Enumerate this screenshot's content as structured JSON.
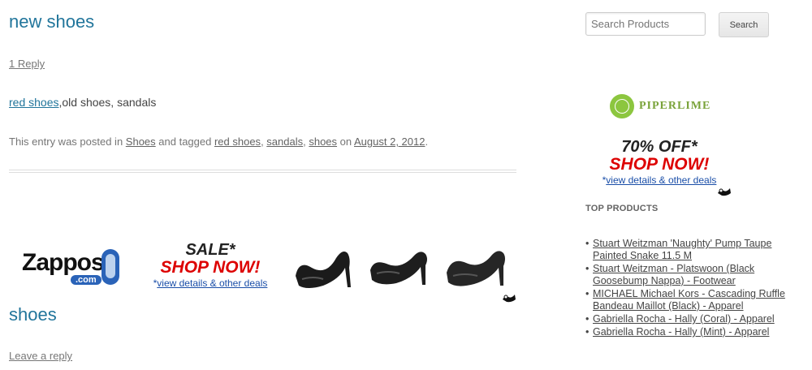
{
  "post1": {
    "title": "new shoes",
    "reply_link": "1 Reply",
    "tags_content": {
      "link_text": "red shoes",
      "rest_text": ",old shoes, sandals"
    },
    "meta": {
      "prefix": "This entry was posted in ",
      "category": "Shoes",
      "tagged_text": " and tagged ",
      "tag1": "red shoes",
      "sep1": ", ",
      "tag2": "sandals",
      "sep2": ", ",
      "tag3": "shoes",
      "on_text": " on ",
      "date": "August 2, 2012",
      "end": "."
    }
  },
  "banner": {
    "brand": "Zappos",
    "brand_suffix": ".com",
    "sale_text": "SALE*",
    "shop_now": "SHOP NOW!",
    "deals_prefix": "*",
    "deals_link": "view details & other deals"
  },
  "post2": {
    "title": "shoes",
    "reply_link": "Leave a reply"
  },
  "sidebar": {
    "search_placeholder": "Search Products",
    "search_button": "Search",
    "ad": {
      "brand": "PIPERLIME",
      "offer_text": "70% OFF*",
      "shop_now": "SHOP NOW!",
      "deals_prefix": "*",
      "deals_link": "view details & other deals"
    },
    "top_products_title": "TOP PRODUCTS",
    "products": [
      "Stuart Weitzman 'Naughty' Pump Taupe Painted Snake 11.5 M",
      "Stuart Weitzman - Platswoon (Black Goosebump Nappa) - Footwear",
      "MICHAEL Michael Kors - Cascading Ruffle Bandeau Maillot (Black) - Apparel",
      "Gabriella Rocha - Hally (Coral) - Apparel",
      "Gabriella Rocha - Hally (Mint) - Apparel"
    ]
  },
  "colors": {
    "title_blue": "#21759b",
    "shop_now_red": "#dd0000",
    "zappos_blue": "#2a63b8",
    "piperlime_green": "#8cc63f"
  },
  "icons": [
    "shoe-icon",
    "badge-icon",
    "piperlime-logo"
  ]
}
